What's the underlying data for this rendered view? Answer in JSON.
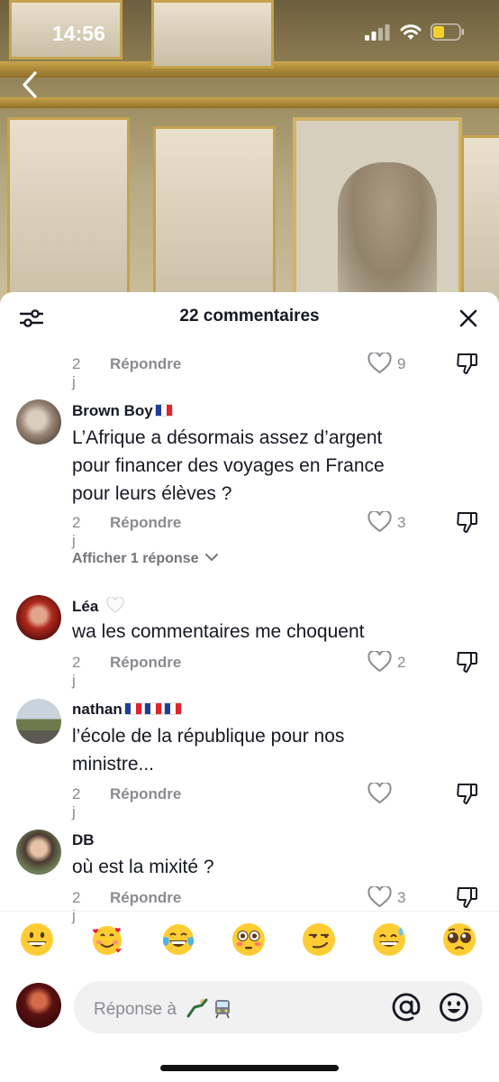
{
  "status": {
    "time": "14:56"
  },
  "sheet": {
    "title": "22 commentaires"
  },
  "first_meta": {
    "age": "2 j",
    "reply": "Répondre",
    "likes": "9"
  },
  "comments": [
    {
      "username": "Brown Boy",
      "text_lines": [
        "L’Afrique a désormais assez d’argent",
        "pour financer des voyages en France",
        "pour leurs élèves ?"
      ],
      "age": "2 j",
      "reply": "Répondre",
      "likes": "3",
      "view_replies": "Afficher 1 réponse"
    },
    {
      "username": "Léa",
      "text_lines": [
        "wa les commentaires me choquent"
      ],
      "age": "2 j",
      "reply": "Répondre",
      "likes": "2"
    },
    {
      "username": "nathan",
      "text_lines": [
        "l’école de la république pour nos",
        "ministre..."
      ],
      "age": "2 j",
      "reply": "Répondre",
      "likes": ""
    },
    {
      "username": "DB",
      "text_lines": [
        "où est la mixité ?"
      ],
      "age": "2 j",
      "reply": "Répondre",
      "likes": "3"
    }
  ],
  "emojis": [
    "grinning-face",
    "smiling-face-with-hearts",
    "tears-of-joy",
    "flushed-face",
    "smirking-face",
    "grinning-sweat",
    "pleading-face"
  ],
  "input": {
    "placeholder": "Réponse à"
  },
  "colors": {
    "accent_text": "#161823",
    "muted": "#8a8b91",
    "battery": "#f5d02a"
  }
}
